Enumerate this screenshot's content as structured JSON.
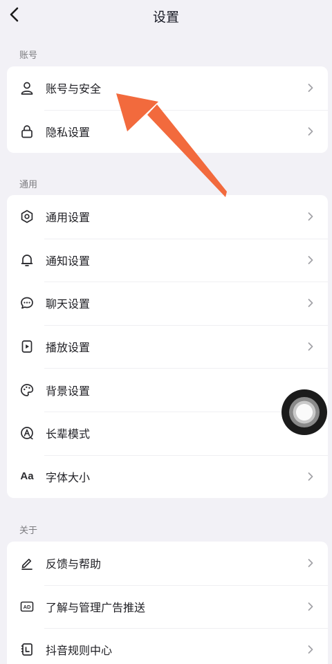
{
  "header": {
    "title": "设置"
  },
  "sections": [
    {
      "label": "账号",
      "items": [
        {
          "label": "账号与安全",
          "icon": "user-icon",
          "chevron": true
        },
        {
          "label": "隐私设置",
          "icon": "lock-icon",
          "chevron": true
        }
      ]
    },
    {
      "label": "通用",
      "items": [
        {
          "label": "通用设置",
          "icon": "gear-icon",
          "chevron": true
        },
        {
          "label": "通知设置",
          "icon": "bell-icon",
          "chevron": true
        },
        {
          "label": "聊天设置",
          "icon": "chat-bubble-icon",
          "chevron": true
        },
        {
          "label": "播放设置",
          "icon": "play-box-icon",
          "chevron": true
        },
        {
          "label": "背景设置",
          "icon": "palette-icon",
          "chevron": false
        },
        {
          "label": "长辈模式",
          "icon": "elder-mode-icon",
          "chevron": false
        },
        {
          "label": "字体大小",
          "icon": "font-size-icon",
          "icon_text": "Aa",
          "chevron": true
        }
      ]
    },
    {
      "label": "关于",
      "items": [
        {
          "label": "反馈与帮助",
          "icon": "pen-icon",
          "chevron": true
        },
        {
          "label": "了解与管理广告推送",
          "icon": "ad-icon",
          "icon_text": "AD",
          "chevron": true
        },
        {
          "label": "抖音规则中心",
          "icon": "rule-book-icon",
          "chevron": true
        }
      ]
    }
  ],
  "colors": {
    "background": "#f2f1f6",
    "card": "#ffffff",
    "annotation_arrow": "#f26a3d",
    "chevron": "#a3a3a8"
  }
}
